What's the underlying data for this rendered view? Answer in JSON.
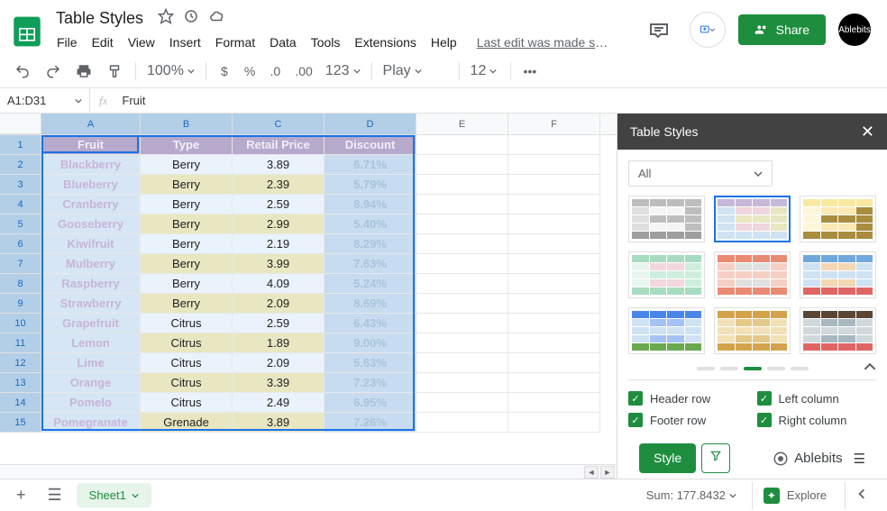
{
  "document": {
    "title": "Table Styles",
    "last_edit": "Last edit was made se..."
  },
  "menu": [
    "File",
    "Edit",
    "View",
    "Insert",
    "Format",
    "Data",
    "Tools",
    "Extensions",
    "Help"
  ],
  "toolbar": {
    "zoom": "100%",
    "font": "Play",
    "font_size": "12"
  },
  "formula_bar": {
    "name_box": "A1:D31",
    "value": "Fruit"
  },
  "share": {
    "label": "Share"
  },
  "avatar": {
    "label": "Ablebits"
  },
  "columns": [
    "A",
    "B",
    "C",
    "D",
    "E",
    "F"
  ],
  "col_widths": {
    "A": 110,
    "B": 102,
    "C": 102,
    "D": 102,
    "E": 102,
    "F": 102
  },
  "selected_cols": [
    "A",
    "B",
    "C",
    "D"
  ],
  "header_row": {
    "cells": [
      {
        "v": "Fruit",
        "bg": "#b6a9cc",
        "fg": "#f3eef9",
        "bold": true
      },
      {
        "v": "Type",
        "bg": "#b6a9cc",
        "fg": "#f3eef9",
        "bold": true
      },
      {
        "v": "Retail Price",
        "bg": "#b6a9cc",
        "fg": "#f3eef9",
        "bold": true
      },
      {
        "v": "Discount",
        "bg": "#b6a9cc",
        "fg": "#f3eef9",
        "bold": true
      }
    ]
  },
  "rows": [
    {
      "A": "Blackberry",
      "B": "Berry",
      "C": "3.89",
      "D": "6.71%",
      "alt": false
    },
    {
      "A": "Blueberry",
      "B": "Berry",
      "C": "2.39",
      "D": "5.79%",
      "alt": true
    },
    {
      "A": "Cranberry",
      "B": "Berry",
      "C": "2.59",
      "D": "8.94%",
      "alt": false
    },
    {
      "A": "Gooseberry",
      "B": "Berry",
      "C": "2.99",
      "D": "5.40%",
      "alt": true
    },
    {
      "A": "Kiwifruit",
      "B": "Berry",
      "C": "2.19",
      "D": "8.29%",
      "alt": false
    },
    {
      "A": "Mulberry",
      "B": "Berry",
      "C": "3.99",
      "D": "7.63%",
      "alt": true
    },
    {
      "A": "Raspberry",
      "B": "Berry",
      "C": "4.09",
      "D": "5.24%",
      "alt": false
    },
    {
      "A": "Strawberry",
      "B": "Berry",
      "C": "2.09",
      "D": "8.69%",
      "alt": true
    },
    {
      "A": "Grapefruit",
      "B": "Citrus",
      "C": "2.59",
      "D": "6.43%",
      "alt": false
    },
    {
      "A": "Lemon",
      "B": "Citrus",
      "C": "1.89",
      "D": "9.00%",
      "alt": true
    },
    {
      "A": "Lime",
      "B": "Citrus",
      "C": "2.09",
      "D": "5.63%",
      "alt": false
    },
    {
      "A": "Orange",
      "B": "Citrus",
      "C": "3.39",
      "D": "7.23%",
      "alt": true
    },
    {
      "A": "Pomelo",
      "B": "Citrus",
      "C": "2.49",
      "D": "6.95%",
      "alt": false
    },
    {
      "A": "Pomegranate",
      "B": "Grenade",
      "C": "3.89",
      "D": "7.26%",
      "alt": true
    }
  ],
  "row_style": {
    "A": {
      "bg_even": "#d6e6f4",
      "bg_odd": "#d6e6f4",
      "fg": "#c8b4d9",
      "bold": true
    },
    "B": {
      "bg_even": "#eaf3fb",
      "bg_odd": "#e8e7c1",
      "fg": "#202124"
    },
    "C": {
      "bg_even": "#eaf3fb",
      "bg_odd": "#e8e7c1",
      "fg": "#202124"
    },
    "D": {
      "bg_even": "#c7dcee",
      "bg_odd": "#c7dcee",
      "fg": "#a9c4dd",
      "bold": true
    }
  },
  "panel": {
    "title": "Table Styles",
    "filter": "All",
    "styles": [
      {
        "colors": [
          "#bdbdbd",
          "#e0e0e0",
          "#f5f5f5",
          "#bdbdbd",
          "#9e9e9e"
        ],
        "active": false
      },
      {
        "colors": [
          "#c5b8d8",
          "#cfe3f2",
          "#f0d6dc",
          "#e8e7c1",
          "#cfe3f2"
        ],
        "active": true
      },
      {
        "colors": [
          "#f9e9a0",
          "#fdf6d8",
          "#fce9b3",
          "#a88d3f",
          "#a88d3f"
        ],
        "active": false
      },
      {
        "colors": [
          "#a8dbc0",
          "#e8f5ee",
          "#f3d7dd",
          "#cdeedd",
          "#a8dbc0"
        ],
        "active": false
      },
      {
        "colors": [
          "#e98b72",
          "#f6cfc3",
          "#e0e0e0",
          "#f6cfc3",
          "#e98b72"
        ],
        "active": false
      },
      {
        "colors": [
          "#6fa8dc",
          "#cfe2f3",
          "#f4d7b3",
          "#cfe2f3",
          "#e06666"
        ],
        "active": false
      },
      {
        "colors": [
          "#4a86e8",
          "#cfe2f3",
          "#a4c2f4",
          "#cfe2f3",
          "#6aa84f"
        ],
        "active": false
      },
      {
        "colors": [
          "#d5a24c",
          "#f3e0b7",
          "#e6c88a",
          "#f3e0b7",
          "#d5a24c"
        ],
        "active": false
      },
      {
        "colors": [
          "#5b4636",
          "#d0d8dc",
          "#a8b8bf",
          "#d0d8dc",
          "#e06666"
        ],
        "active": false
      }
    ],
    "options": {
      "header_row": {
        "label": "Header row",
        "checked": true
      },
      "left_column": {
        "label": "Left column",
        "checked": true
      },
      "footer_row": {
        "label": "Footer row",
        "checked": true
      },
      "right_column": {
        "label": "Right column",
        "checked": true
      }
    },
    "style_btn": "Style",
    "brand": "Ablebits"
  },
  "bottom": {
    "sheet_tab": "Sheet1",
    "sum": "Sum: 177.8432",
    "explore": "Explore"
  }
}
